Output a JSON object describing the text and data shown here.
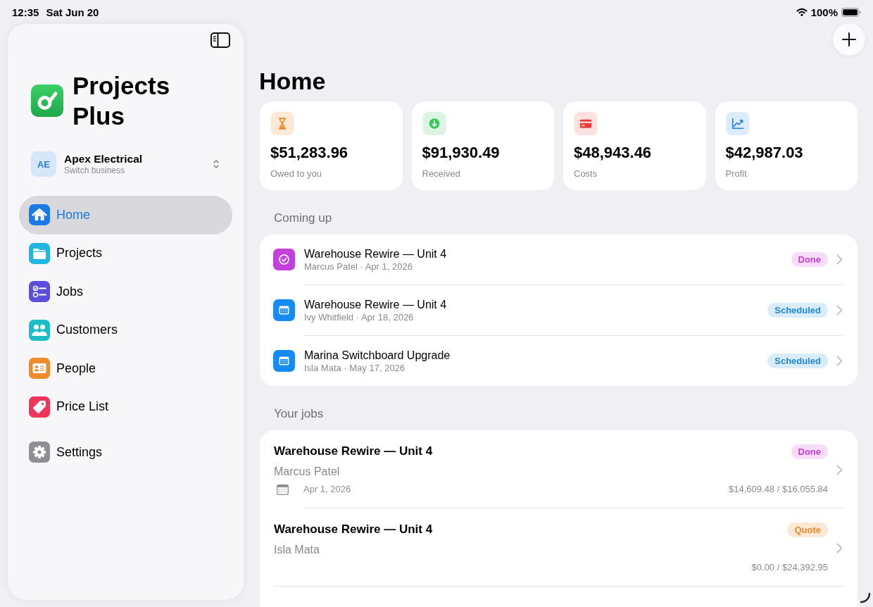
{
  "status_bar": {
    "time": "12:35",
    "date": "Sat Jun 20",
    "battery": "100%"
  },
  "sidebar": {
    "app_name": "Projects Plus",
    "account": {
      "initials": "AE",
      "name": "Apex Electrical",
      "subtitle": "Switch business"
    },
    "items": [
      {
        "label": "Home",
        "kind": "home",
        "selected": true
      },
      {
        "label": "Projects",
        "kind": "projects",
        "selected": false
      },
      {
        "label": "Jobs",
        "kind": "jobs",
        "selected": false
      },
      {
        "label": "Customers",
        "kind": "customers",
        "selected": false
      },
      {
        "label": "People",
        "kind": "people",
        "selected": false
      },
      {
        "label": "Price List",
        "kind": "pricelist",
        "selected": false
      }
    ],
    "footer_items": [
      {
        "label": "Settings",
        "kind": "settings",
        "selected": false
      }
    ]
  },
  "main": {
    "title": "Home",
    "stats": [
      {
        "kind": "owed",
        "amount": "$51,283.96",
        "label": "Owed to you"
      },
      {
        "kind": "received",
        "amount": "$91,930.49",
        "label": "Received"
      },
      {
        "kind": "costs",
        "amount": "$48,943.46",
        "label": "Costs"
      },
      {
        "kind": "profit",
        "amount": "$42,987.03",
        "label": "Profit"
      }
    ],
    "coming_up": {
      "heading": "Coming up",
      "items": [
        {
          "title": "Warehouse Rewire — Unit 4",
          "subtitle": "Marcus Patel · Apr 1, 2026",
          "status": "Done",
          "kind": "done"
        },
        {
          "title": "Warehouse Rewire — Unit 4",
          "subtitle": "Ivy Whitfield · Apr 18, 2026",
          "status": "Scheduled",
          "kind": "scheduled"
        },
        {
          "title": "Marina Switchboard Upgrade",
          "subtitle": "Isla Mata · May 17, 2026",
          "status": "Scheduled",
          "kind": "scheduled"
        }
      ]
    },
    "your_jobs": {
      "heading": "Your jobs",
      "items": [
        {
          "title": "Warehouse Rewire — Unit 4",
          "customer": "Marcus Patel",
          "date": "Apr 1, 2026",
          "amount": "$14,609.48 / $16,055.84",
          "status": "Done",
          "kind": "done"
        },
        {
          "title": "Warehouse Rewire — Unit 4",
          "customer": "Isla Mata",
          "amount": "$0.00 / $24,392.95",
          "status": "Quote",
          "kind": "quote"
        }
      ]
    }
  }
}
